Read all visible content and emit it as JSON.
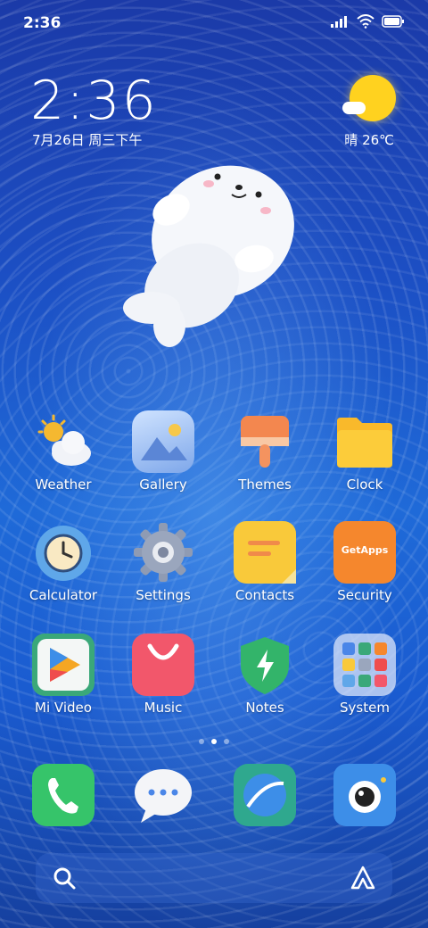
{
  "status_bar": {
    "time": "2:36"
  },
  "clock_widget": {
    "time": "2:36",
    "date": "7月26日 周三下午"
  },
  "weather_widget": {
    "condition": "晴",
    "temperature": "26℃",
    "summary": "晴 26℃"
  },
  "apps": [
    {
      "label": "Weather",
      "icon": "weather-icon"
    },
    {
      "label": "Gallery",
      "icon": "gallery-icon"
    },
    {
      "label": "Themes",
      "icon": "themes-icon"
    },
    {
      "label": "Clock",
      "icon": "folder-icon"
    },
    {
      "label": "Calculator",
      "icon": "clock-icon"
    },
    {
      "label": "Settings",
      "icon": "settings-gear-icon"
    },
    {
      "label": "Contacts",
      "icon": "notes-icon"
    },
    {
      "label": "Security",
      "icon": "getapps-bag-icon",
      "badge_text": "GetApps"
    },
    {
      "label": "Mi Video",
      "icon": "play-icon"
    },
    {
      "label": "Music",
      "icon": "shopping-bag-icon"
    },
    {
      "label": "Notes",
      "icon": "shield-icon"
    },
    {
      "label": "System",
      "icon": "folder-grid-icon"
    }
  ],
  "page_indicator": {
    "pages": 3,
    "active": 2
  },
  "dock": [
    {
      "icon": "phone-icon"
    },
    {
      "icon": "messages-icon"
    },
    {
      "icon": "browser-icon"
    },
    {
      "icon": "camera-icon"
    }
  ],
  "bottom_bar": {
    "left_icon": "search-icon",
    "right_icon": "app-vault-icon"
  }
}
